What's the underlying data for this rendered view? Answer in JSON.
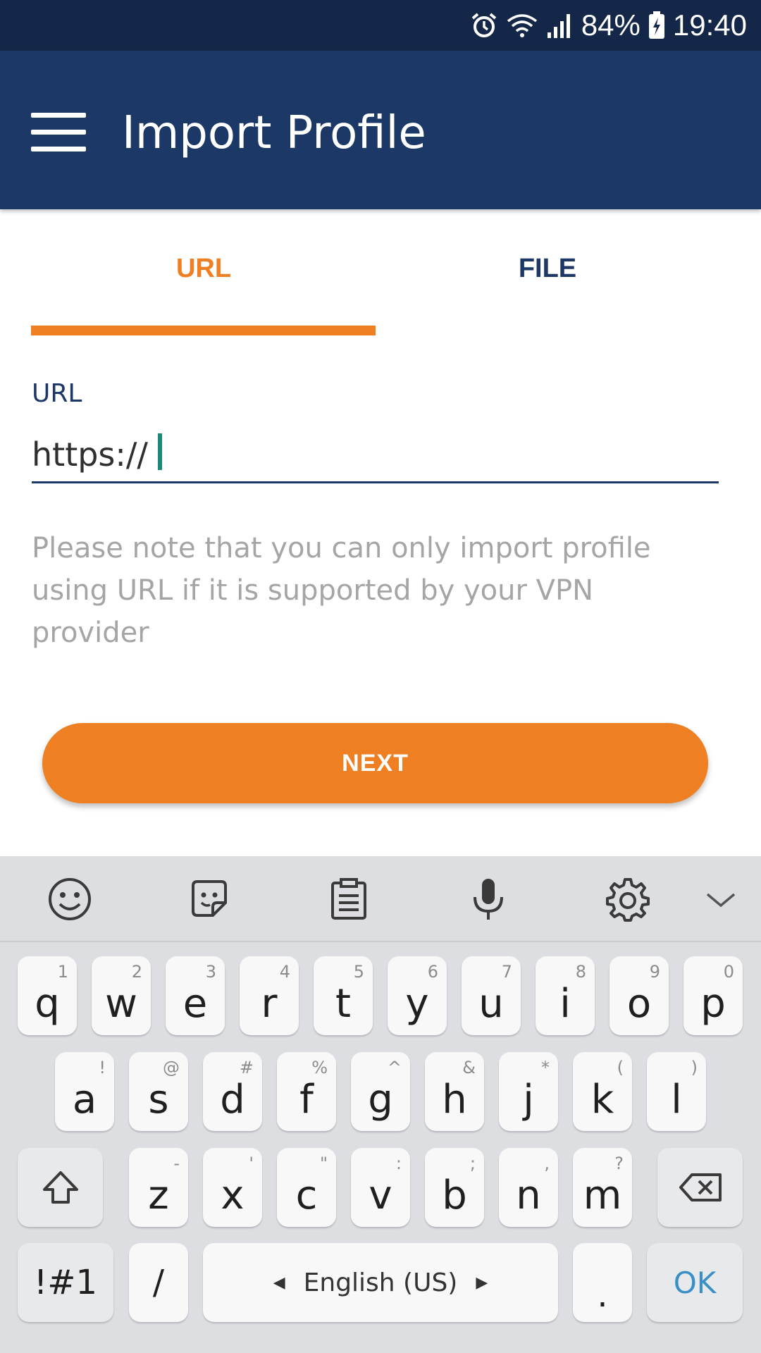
{
  "status_bar": {
    "battery_percent": "84%",
    "time": "19:40",
    "icons": [
      "alarm-icon",
      "wifi-icon",
      "signal-icon",
      "battery-charging-icon"
    ]
  },
  "app_bar": {
    "title": "Import Profile",
    "menu_icon": "hamburger-menu-icon"
  },
  "tabs": [
    {
      "label": "URL",
      "selected": true
    },
    {
      "label": "FILE",
      "selected": false
    }
  ],
  "url_field": {
    "label": "URL",
    "value": "https://"
  },
  "help_text": "Please note that you can only import profile using URL if it is supported by your VPN provider",
  "next_button": {
    "label": "NEXT"
  },
  "colors": {
    "status_bar": "#152748",
    "app_bar": "#1c3867",
    "accent": "#ee7f22",
    "navy": "#1d3866",
    "hint_gray": "#a5a5a5",
    "keyboard_bg": "#dcdee2",
    "ok_blue": "#3a8fc6"
  },
  "keyboard": {
    "toolbar_icons": [
      "emoji-icon",
      "sticker-icon",
      "clipboard-icon",
      "microphone-icon",
      "settings-icon",
      "collapse-keyboard-icon"
    ],
    "row1": [
      {
        "key": "q",
        "sup": "1"
      },
      {
        "key": "w",
        "sup": "2"
      },
      {
        "key": "e",
        "sup": "3"
      },
      {
        "key": "r",
        "sup": "4"
      },
      {
        "key": "t",
        "sup": "5"
      },
      {
        "key": "y",
        "sup": "6"
      },
      {
        "key": "u",
        "sup": "7"
      },
      {
        "key": "i",
        "sup": "8"
      },
      {
        "key": "o",
        "sup": "9"
      },
      {
        "key": "p",
        "sup": "0"
      }
    ],
    "row2": [
      {
        "key": "a",
        "sup": "!"
      },
      {
        "key": "s",
        "sup": "@"
      },
      {
        "key": "d",
        "sup": "#"
      },
      {
        "key": "f",
        "sup": "%"
      },
      {
        "key": "g",
        "sup": "^"
      },
      {
        "key": "h",
        "sup": "&"
      },
      {
        "key": "j",
        "sup": "*"
      },
      {
        "key": "k",
        "sup": "("
      },
      {
        "key": "l",
        "sup": ")"
      }
    ],
    "row3": [
      {
        "key": "z",
        "sup": "-"
      },
      {
        "key": "x",
        "sup": "'"
      },
      {
        "key": "c",
        "sup": "\""
      },
      {
        "key": "v",
        "sup": ":"
      },
      {
        "key": "b",
        "sup": ";"
      },
      {
        "key": "n",
        "sup": ","
      },
      {
        "key": "m",
        "sup": "?"
      }
    ],
    "shift_icon": "shift-icon",
    "backspace_icon": "backspace-icon",
    "symbols_label": "!#1",
    "slash_label": "/",
    "space_label": "English (US)",
    "period_label": ".",
    "ok_label": "OK"
  }
}
